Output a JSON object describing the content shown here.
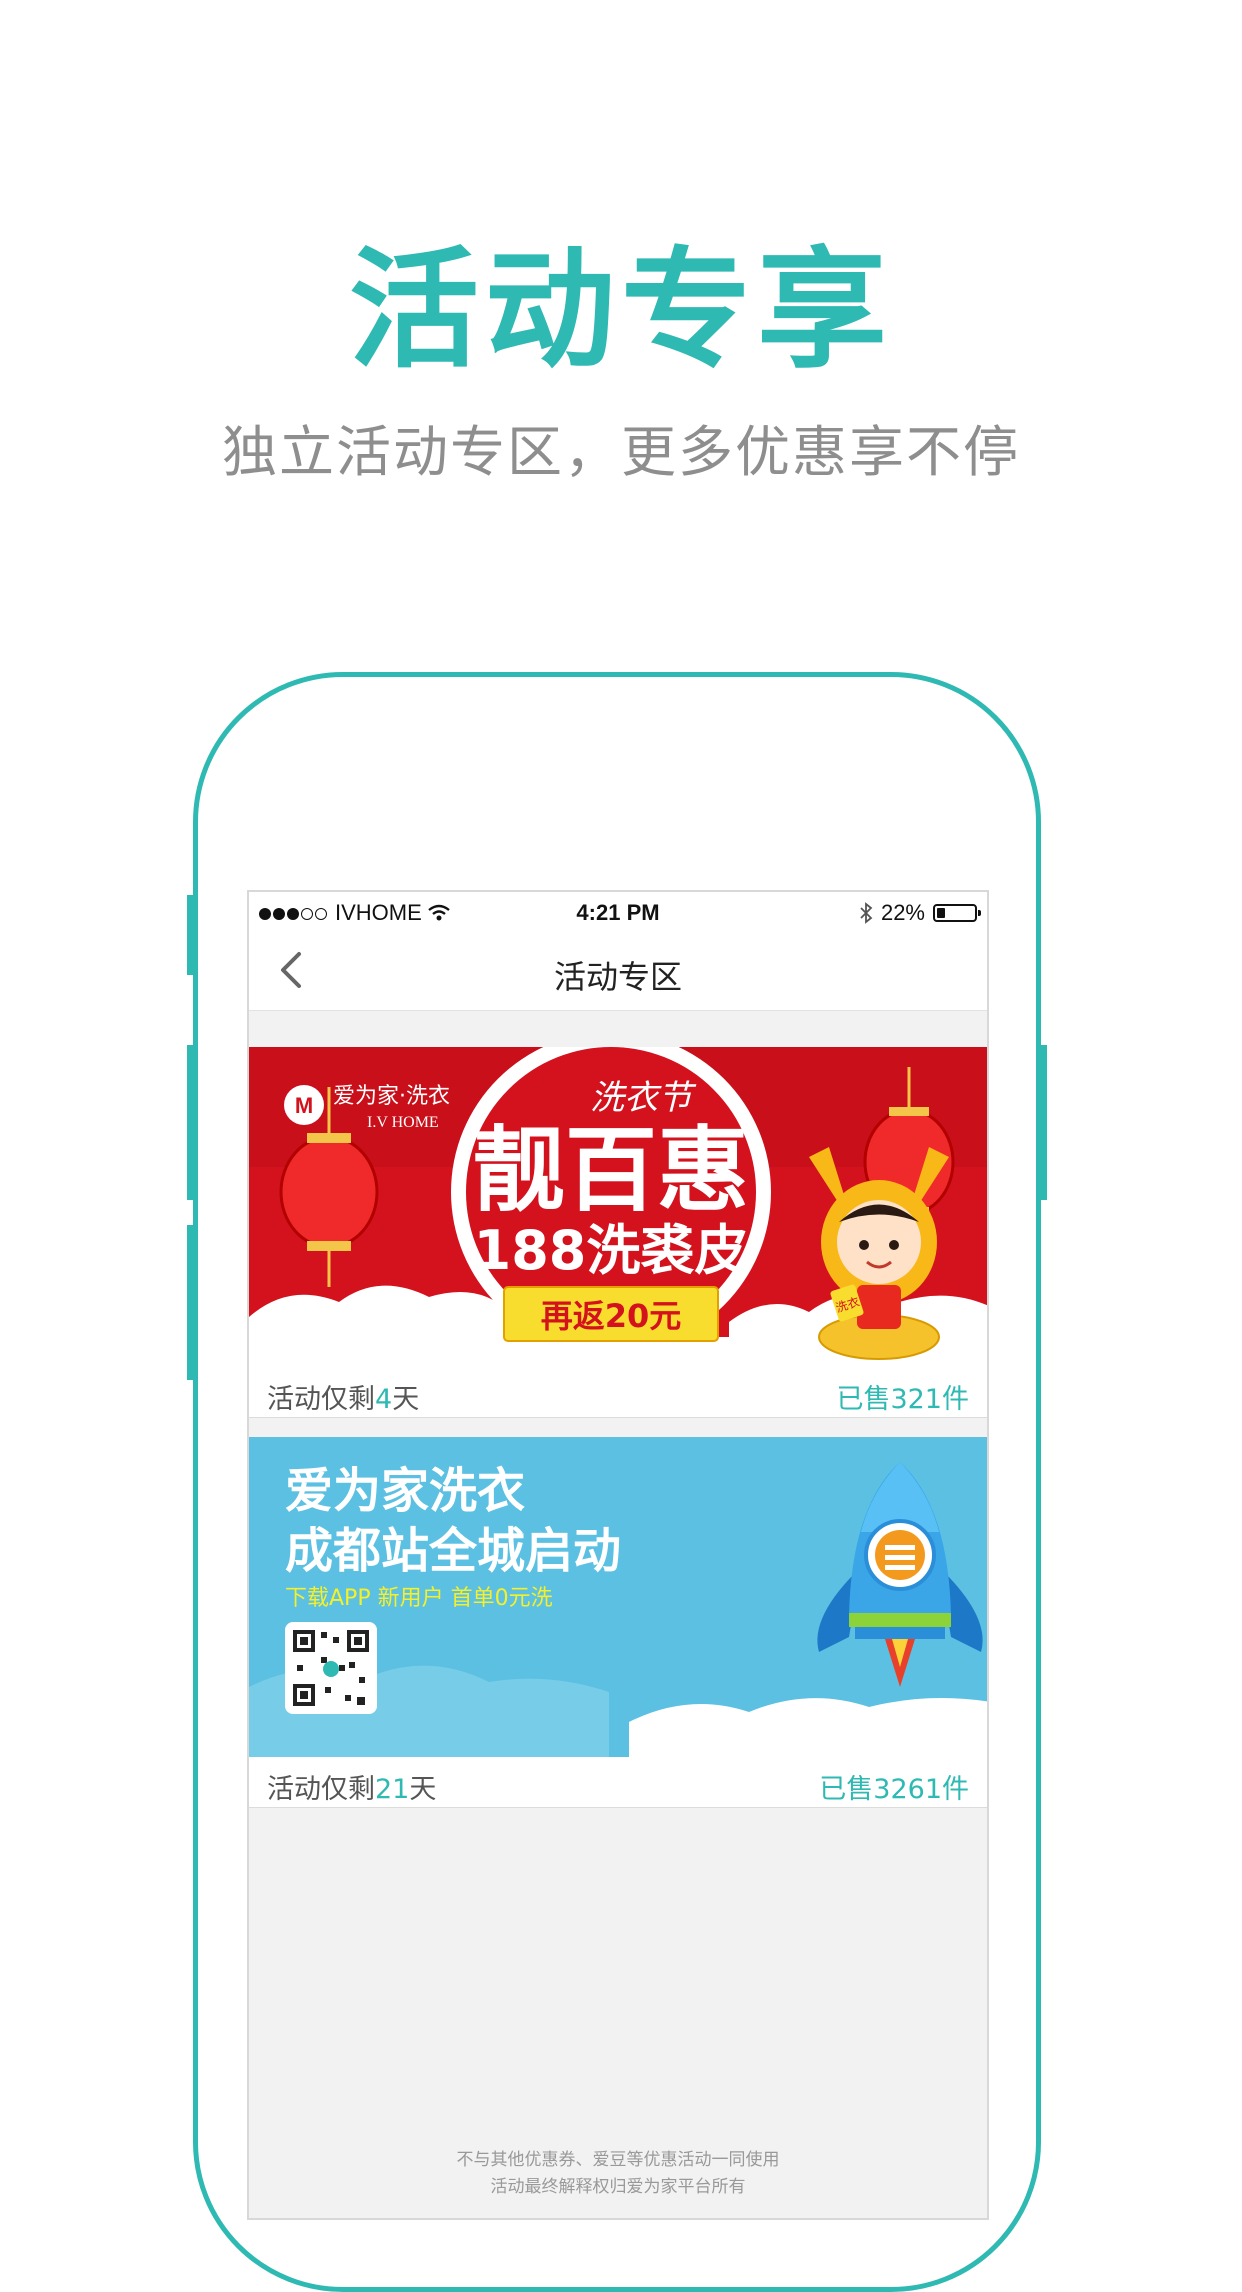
{
  "hero": {
    "title": "活动专享",
    "subtitle": "独立活动专区，更多优惠享不停"
  },
  "statusbar": {
    "carrier": "IVHOME",
    "time": "4:21 PM",
    "battery": "22%",
    "battery_level": 0.22
  },
  "navbar": {
    "title": "活动专区"
  },
  "cards": [
    {
      "banner": {
        "brand_cn": "爱为家·洗衣",
        "brand_en": "I.V HOME",
        "festival": "洗衣节",
        "headline": "靓百惠",
        "subline": "188洗裘皮",
        "button": "再返20元",
        "bag_text": "洗衣"
      },
      "remain_prefix": "活动仅剩",
      "remain_num": "4",
      "remain_suffix": "天",
      "sold": "已售321件"
    },
    {
      "banner": {
        "line1": "爱为家洗衣",
        "line2": "成都站全城启动",
        "line3": "下载APP  新用户  首单0元洗"
      },
      "remain_prefix": "活动仅剩",
      "remain_num": "21",
      "remain_suffix": "天",
      "sold": "已售3261件"
    }
  ],
  "footer": {
    "line1": "不与其他优惠券、爱豆等优惠活动一同使用",
    "line2": "活动最终解释权归爱为家平台所有"
  },
  "colors": {
    "accent": "#2fb9b3",
    "banner_red": "#d4121e",
    "banner_blue": "#5bc0e2",
    "gold": "#f9dd2e"
  }
}
